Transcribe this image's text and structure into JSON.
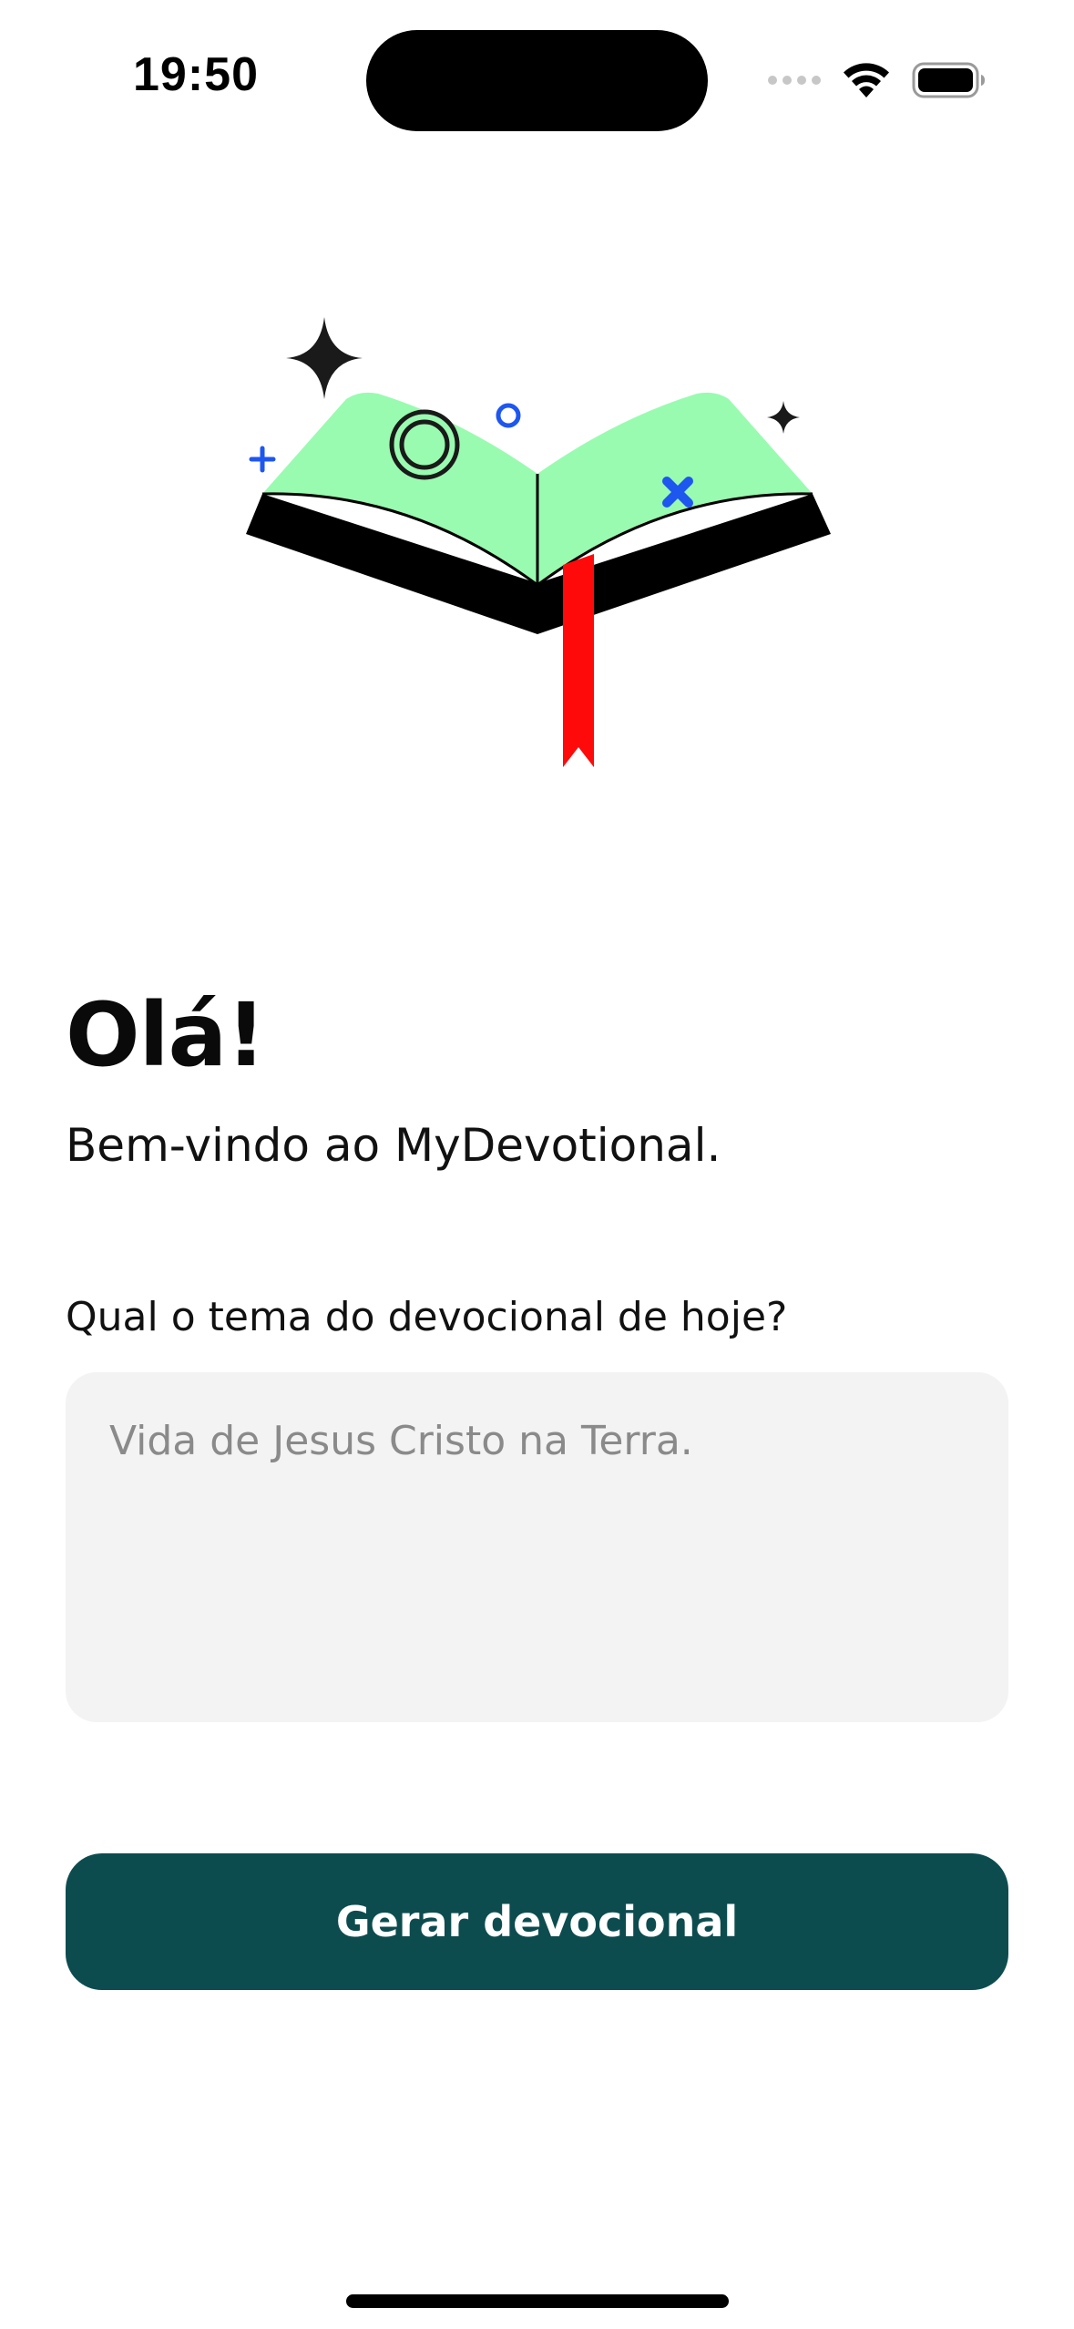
{
  "status_bar": {
    "time": "19:50",
    "icons": [
      "signal-dots-icon",
      "wifi-icon",
      "battery-icon"
    ]
  },
  "illustration": {
    "subject": "open-book-icon",
    "colors": {
      "pages": "#99fbb0",
      "cover": "#000000",
      "bookmark": "#ff0a0a",
      "accent_blue": "#1e56f0",
      "dark_sparkle": "#1a1a1a"
    }
  },
  "main": {
    "greeting": "Olá!",
    "welcome": "Bem-vindo ao MyDevotional.",
    "question": "Qual o tema do devocional de hoje?",
    "theme_input": {
      "value": "",
      "placeholder": "Vida de Jesus Cristo na Terra."
    },
    "generate_label": "Gerar devocional"
  },
  "colors": {
    "button_bg": "#0c4c4f",
    "field_bg": "#f3f3f3"
  }
}
